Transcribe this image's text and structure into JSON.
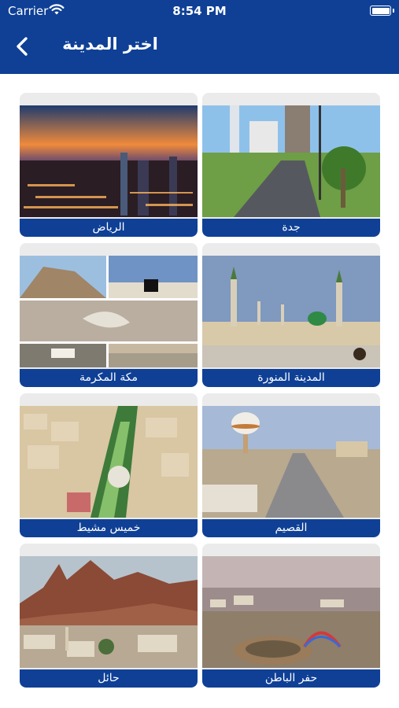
{
  "status_bar": {
    "carrier": "Carrier",
    "time": "8:54 PM",
    "battery_level": 1.0
  },
  "header": {
    "title": "اختر المدينة",
    "back_icon": "chevron-left-icon",
    "background_color": "#0f4096"
  },
  "cities": [
    {
      "name": "الرياض"
    },
    {
      "name": "جدة"
    },
    {
      "name": "مكة المكرمة"
    },
    {
      "name": "المدينة المنورة"
    },
    {
      "name": "خميس مشيط"
    },
    {
      "name": "القصيم"
    },
    {
      "name": "حائل"
    },
    {
      "name": "حفر الباطن"
    }
  ]
}
